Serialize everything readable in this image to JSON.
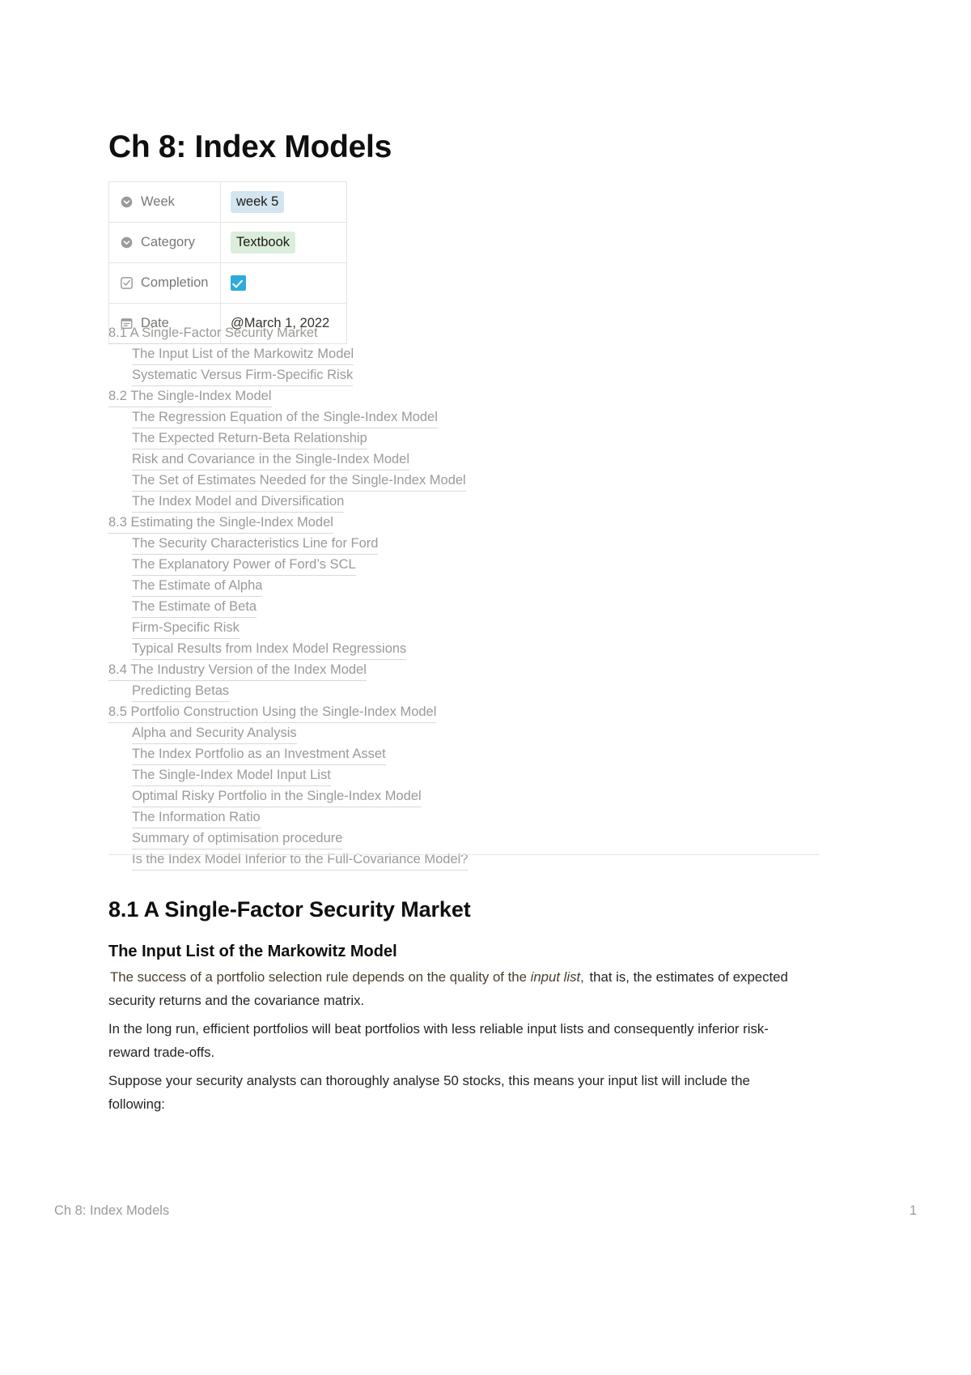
{
  "document": {
    "title": "Ch 8: Index Models"
  },
  "properties": [
    {
      "icon": "select-chevron-circle-icon",
      "name": "Week",
      "type": "pill",
      "value": "week 5",
      "color": "#d3e5ef"
    },
    {
      "icon": "select-chevron-circle-icon",
      "name": "Category",
      "type": "pill",
      "value": "Textbook",
      "color": "#dbeddb"
    },
    {
      "icon": "checkbox-property-icon",
      "name": "Completion",
      "type": "checkbox",
      "value": true,
      "color": "#2eaadc"
    },
    {
      "icon": "calendar-icon",
      "name": "Date",
      "type": "date",
      "value": "@March 1, 2022"
    }
  ],
  "table_of_contents": [
    {
      "level": 1,
      "label": "8.1 A Single-Factor Security Market"
    },
    {
      "level": 2,
      "label": "The Input List of the Markowitz Model"
    },
    {
      "level": 2,
      "label": "Systematic Versus Firm-Specific Risk"
    },
    {
      "level": 1,
      "label": "8.2 The Single-Index Model"
    },
    {
      "level": 2,
      "label": "The Regression Equation of the Single-Index Model"
    },
    {
      "level": 2,
      "label": "The Expected Return-Beta Relationship"
    },
    {
      "level": 2,
      "label": "Risk and Covariance in the Single-Index Model"
    },
    {
      "level": 2,
      "label": "The Set of Estimates Needed for the Single-Index Model"
    },
    {
      "level": 2,
      "label": "The Index Model and Diversification"
    },
    {
      "level": 1,
      "label": "8.3 Estimating the Single-Index Model"
    },
    {
      "level": 2,
      "label": "The Security Characteristics Line for Ford"
    },
    {
      "level": 2,
      "label": "The Explanatory Power of Ford’s SCL"
    },
    {
      "level": 2,
      "label": "The Estimate of Alpha"
    },
    {
      "level": 2,
      "label": "The Estimate of Beta"
    },
    {
      "level": 2,
      "label": "Firm-Specific Risk"
    },
    {
      "level": 2,
      "label": "Typical Results from Index Model Regressions"
    },
    {
      "level": 1,
      "label": "8.4 The Industry Version of the Index Model"
    },
    {
      "level": 2,
      "label": "Predicting Betas"
    },
    {
      "level": 1,
      "label": "8.5 Portfolio Construction Using the Single-Index Model"
    },
    {
      "level": 2,
      "label": "Alpha and Security Analysis"
    },
    {
      "level": 2,
      "label": "The Index Portfolio as an Investment Asset"
    },
    {
      "level": 2,
      "label": "The Single-Index Model Input List"
    },
    {
      "level": 2,
      "label": "Optimal Risky Portfolio in the Single-Index Model"
    },
    {
      "level": 2,
      "label": "The Information Ratio"
    },
    {
      "level": 2,
      "label": "Summary of optimisation procedure"
    },
    {
      "level": 2,
      "label": "Is the Index Model Inferior to the Full-Covariance Model?"
    }
  ],
  "body": {
    "heading_1": "8.1 A Single-Factor Security Market",
    "heading_2": "The Input List of the Markowitz Model",
    "paragraph_1": {
      "highlighted_prefix": "The success of a portfolio selection rule depends on the quality of the ",
      "highlighted_italic": "input list",
      "highlighted_suffix": ",",
      "rest": " that is, the estimates of expected security returns and the covariance matrix.",
      "highlight_color": "#fbeaa6"
    },
    "paragraph_2": "In the long run, efficient portfolios will beat portfolios with less reliable input lists and consequently inferior risk-reward trade-offs.",
    "paragraph_3": "Suppose your security analysts can thoroughly analyse 50 stocks, this means your input list will include the following:"
  },
  "footer": {
    "left": "Ch 8: Index Models",
    "page_number": "1"
  }
}
